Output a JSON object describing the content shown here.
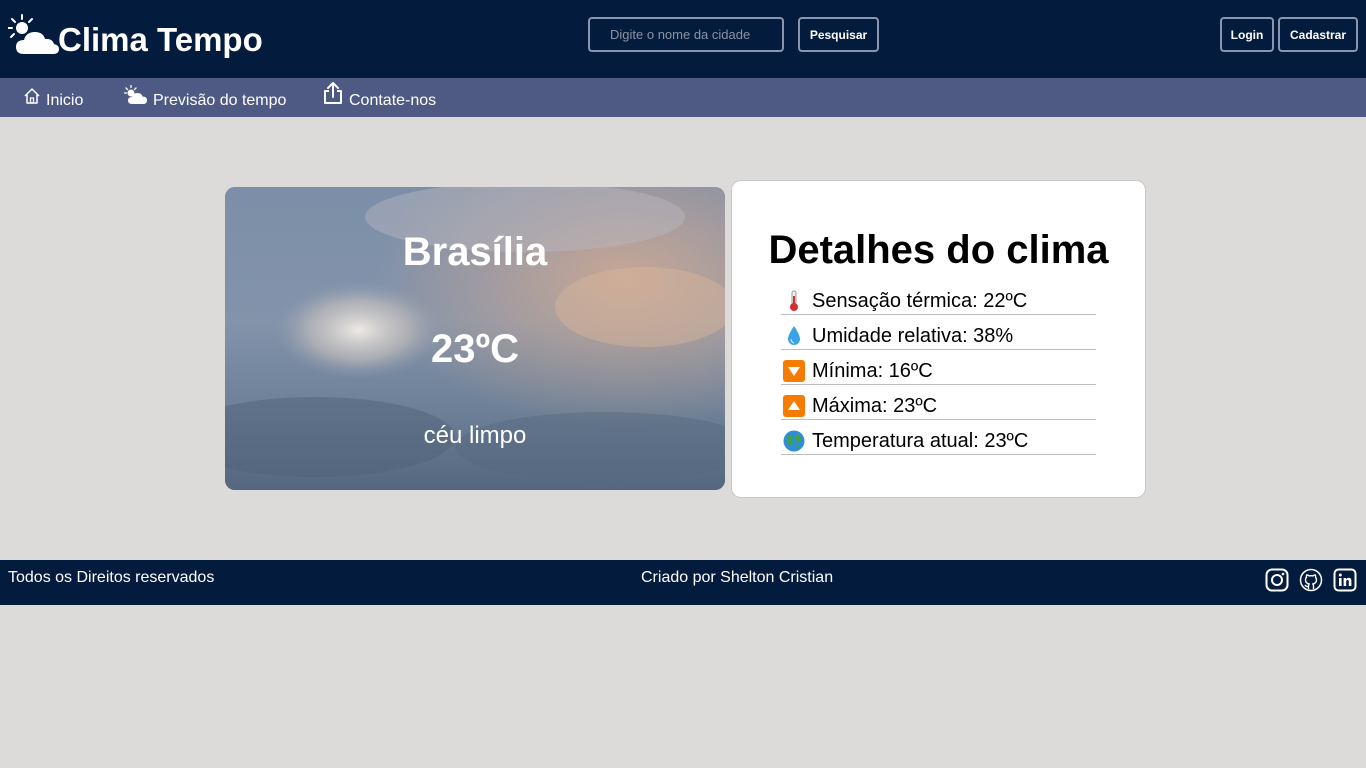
{
  "header": {
    "title": "Clima Tempo",
    "search": {
      "placeholder": "Digite o nome da cidade",
      "value": ""
    },
    "search_button": "Pesquisar",
    "login_button": "Login",
    "register_button": "Cadastrar"
  },
  "nav": {
    "items": [
      {
        "label": "Inicio",
        "icon": "home-icon"
      },
      {
        "label": "Previsão do tempo",
        "icon": "sun-cloud-icon"
      },
      {
        "label": "Contate-nos",
        "icon": "share-icon"
      }
    ]
  },
  "weather": {
    "city": "Brasília",
    "temperature": "23ºC",
    "description": "céu limpo"
  },
  "details": {
    "title": "Detalhes do clima",
    "items": [
      {
        "icon": "thermometer-icon",
        "text": "Sensação térmica: 22ºC"
      },
      {
        "icon": "droplet-icon",
        "text": "Umidade relativa: 38%"
      },
      {
        "icon": "arrow-down-icon",
        "text": "Mínima: 16ºC"
      },
      {
        "icon": "arrow-up-icon",
        "text": "Máxima: 23ºC"
      },
      {
        "icon": "globe-icon",
        "text": "Temperatura atual: 23ºC"
      }
    ]
  },
  "footer": {
    "rights": "Todos os Direitos reservados",
    "credit": "Criado por Shelton Cristian",
    "social": [
      "instagram-icon",
      "github-icon",
      "linkedin-icon"
    ]
  },
  "colors": {
    "header_bg": "#031b3c",
    "nav_bg": "#4e5a84",
    "page_bg": "#dcdbd9",
    "button_border": "#8a96b0"
  }
}
